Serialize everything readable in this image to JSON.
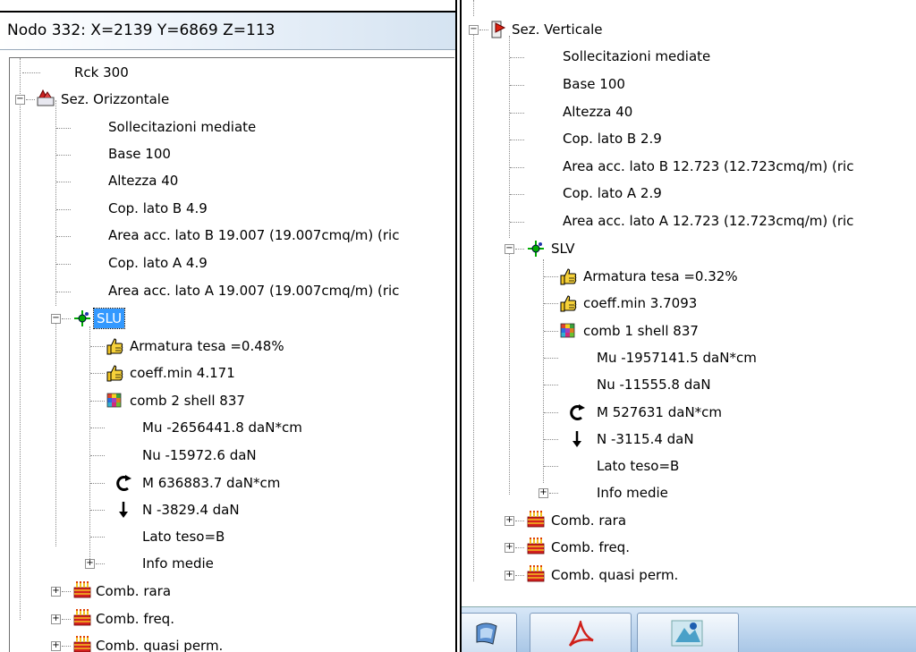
{
  "left": {
    "title": "Nodo 332: X=2139 Y=6869 Z=113",
    "tree": {
      "rck": "Rck 300",
      "sez_orizzontale": {
        "label": "Sez. Orizzontale",
        "items": [
          "Sollecitazioni mediate",
          "Base 100",
          "Altezza 40",
          "Cop. lato B 4.9",
          "Area acc. lato B  19.007 (19.007cmq/m) (ric",
          "Cop. lato A 4.9",
          "Area acc. lato A  19.007 (19.007cmq/m) (ric"
        ]
      },
      "slu": {
        "label": "SLU",
        "armatura": "Armatura tesa =0.48%",
        "coeff": "coeff.min 4.171",
        "comb": "comb 2 shell 837",
        "mu": "Mu -2656441.8 daN*cm",
        "nu": "Nu -15972.6 daN",
        "m": "M 636883.7 daN*cm",
        "n": "N -3829.4 daN",
        "lato": "Lato teso=B",
        "info": "Info medie"
      },
      "comb_rara": "Comb. rara",
      "comb_freq": "Comb. freq.",
      "comb_quasi": "Comb. quasi perm."
    }
  },
  "right": {
    "tree": {
      "sez_verticale": {
        "label": "Sez. Verticale",
        "items": [
          "Sollecitazioni mediate",
          "Base 100",
          "Altezza 40",
          "Cop. lato B 2.9",
          "Area acc. lato B  12.723 (12.723cmq/m) (ric",
          "Cop. lato A 2.9",
          "Area acc. lato A  12.723 (12.723cmq/m) (ric"
        ]
      },
      "slv": {
        "label": "SLV",
        "armatura": "Armatura tesa =0.32%",
        "coeff": "coeff.min 3.7093",
        "comb": "comb 1 shell 837",
        "mu": "Mu -1957141.5 daN*cm",
        "nu": "Nu -11555.8 daN",
        "m": "M 527631 daN*cm",
        "n": "N -3115.4 daN",
        "lato": "Lato teso=B",
        "info": "Info medie"
      },
      "comb_rara": "Comb. rara",
      "comb_freq": "Comb. freq.",
      "comb_quasi": "Comb. quasi perm."
    },
    "taskbar": {
      "buttons": [
        "app-icon",
        "pdf-icon",
        "image-icon"
      ]
    }
  },
  "colors": {
    "selection": "#3399ff",
    "titlebar_gradient_end": "#d5e3f1",
    "taskbar": "#a8c6e6"
  },
  "icons": {
    "section_horizontal": "section-horizontal-icon",
    "section_vertical": "section-vertical-icon",
    "limit_state": "crosshair-icon",
    "thumb": "thumbs-up-icon",
    "comb": "colored-grid-icon",
    "moment": "curved-arrow-icon",
    "force": "down-arrow-icon",
    "combo_group": "cake-icon"
  }
}
